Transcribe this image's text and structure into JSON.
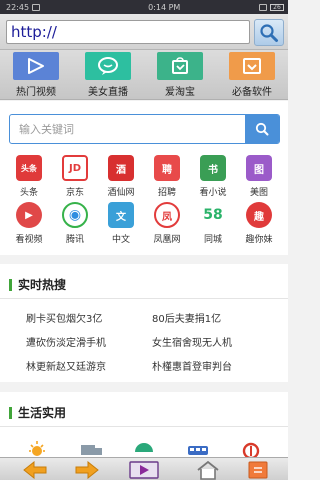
{
  "status_bar": {
    "time": "22:45",
    "mid_time": "0:14 PM",
    "battery": "26"
  },
  "url_bar": {
    "value": "http://"
  },
  "features": [
    {
      "label": "热门视频",
      "color": "#5b83d6",
      "icon": "play-icon"
    },
    {
      "label": "美女直播",
      "color": "#2dbfa0",
      "icon": "chat-bubble-icon"
    },
    {
      "label": "爱淘宝",
      "color": "#3cb38a",
      "icon": "bag-icon"
    },
    {
      "label": "必备软件",
      "color": "#f09b4a",
      "icon": "download-icon"
    }
  ],
  "search": {
    "placeholder": "输入关键词"
  },
  "apps": [
    {
      "label": "头条",
      "glyph": "头条",
      "color": "#e03a3a"
    },
    {
      "label": "京东",
      "glyph": "JD",
      "color": "#e23b3b"
    },
    {
      "label": "酒仙网",
      "glyph": "酒",
      "color": "#d83030"
    },
    {
      "label": "招聘",
      "glyph": "聘",
      "color": "#e84a4a"
    },
    {
      "label": "看小说",
      "glyph": "书",
      "color": "#3a9e55"
    },
    {
      "label": "美图",
      "glyph": "图",
      "color": "#9b5bc9"
    },
    {
      "label": "看视频",
      "glyph": "▶",
      "color": "#e04848"
    },
    {
      "label": "腾讯",
      "glyph": "◉",
      "color": "#2e8de0"
    },
    {
      "label": "中文",
      "glyph": "文",
      "color": "#3aa0d8"
    },
    {
      "label": "凤凰网",
      "glyph": "凤",
      "color": "#e23c3c"
    },
    {
      "label": "同城",
      "glyph": "58",
      "color": "#ffffff"
    },
    {
      "label": "趣你妹",
      "glyph": "趣",
      "color": "#e03a3a"
    }
  ],
  "hot_search": {
    "title": "实时热搜",
    "items": [
      "刷卡买包烟欠3亿",
      "80后夫妻捐1亿",
      "遭砍伤淡定滑手机",
      "女生宿舍现无人机",
      "林更新赵又廷游京",
      "朴槿惠首登审判台"
    ]
  },
  "life": {
    "title": "生活实用",
    "icons": [
      "sun-icon",
      "truck-icon",
      "half-circle-icon",
      "bus-icon",
      "train-icon"
    ]
  },
  "bottom_nav": [
    "back-arrow-icon",
    "forward-arrow-icon",
    "video-icon",
    "home-icon",
    "menu-icon"
  ],
  "colors": {
    "accent": "#4a90d9",
    "section_bar": "#41a53a",
    "nav_arrow": "#f0a020"
  }
}
